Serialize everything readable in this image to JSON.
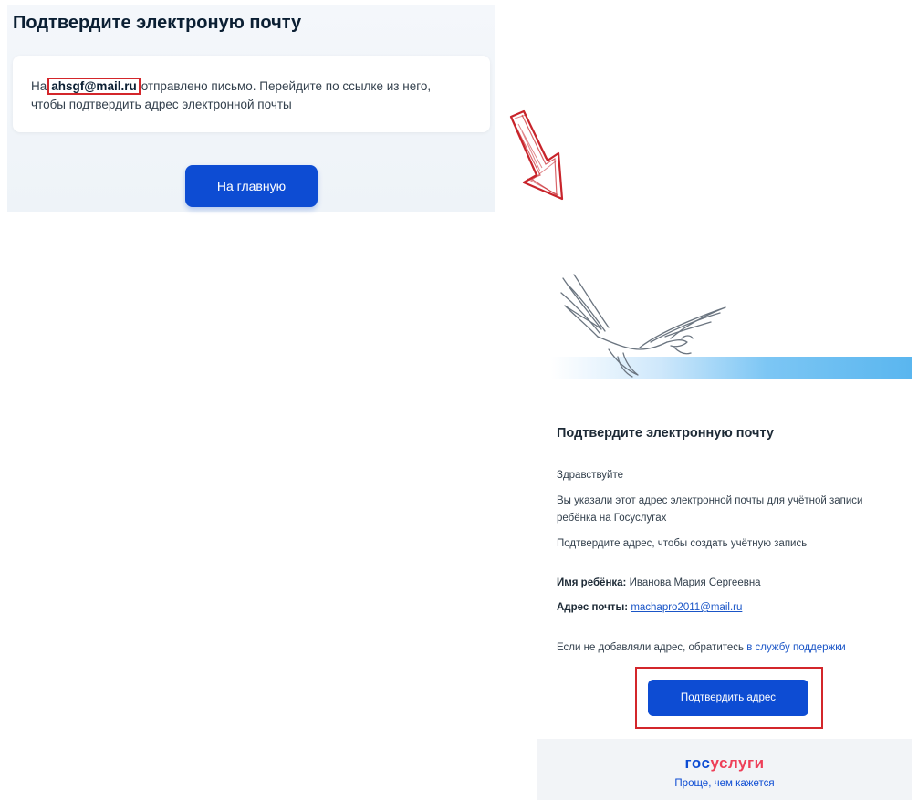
{
  "confirm_page": {
    "title": "Подтвердите электроную почту",
    "message_prefix": "На",
    "email": "ahsgf@mail.ru",
    "message_suffix": "отправлено письмо. Перейдите по ссылке из него,",
    "message_line2": "чтобы подтвердить адрес электронной почты",
    "home_button": "На главную"
  },
  "email_message": {
    "title": "Подтвердите электронную почту",
    "greeting": "Здравствуйте",
    "body_line1": "Вы указали этот адрес электронной почты для учётной записи",
    "body_line2": "ребёнка на Госуслугах",
    "body_line3": "Подтвердите адрес, чтобы создать учётную запись",
    "child_name_label": "Имя ребёнка:",
    "child_name_value": "Иванова Мария Сергеевна",
    "email_label": "Адрес почты:",
    "email_value": "machapro2011@mail.ru",
    "support_prefix": "Если не добавляли адрес, обратитесь",
    "support_link": "в службу поддержки",
    "confirm_button": "Подтвердить адрес",
    "logo_part1": "гос",
    "logo_part2": "услуги",
    "slogan": "Проще, чем кажется"
  },
  "colors": {
    "accent_blue": "#0d4cd3",
    "highlight_red": "#d3262b",
    "logo_red": "#ee3f58"
  },
  "icons": [
    "dove-illustration",
    "red-arrow-icon"
  ]
}
